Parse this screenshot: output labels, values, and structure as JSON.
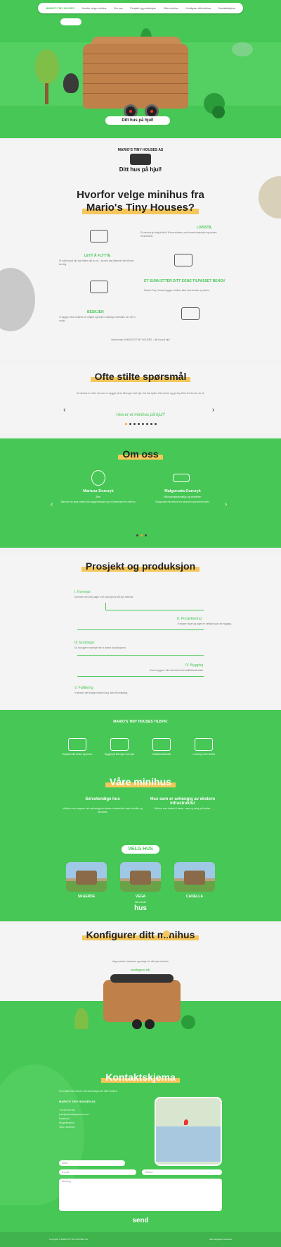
{
  "nav": {
    "logo": "MARIO'S TINY HOUSES",
    "items": [
      "Hvorfor velge minihus",
      "Om oss",
      "Prosjekt og produksjon",
      "Våre minihus",
      "Konfigurer ditt minihus",
      "Kontaktskjema"
    ]
  },
  "hero": {
    "tagline": "Ditt hus på hjul!"
  },
  "why": {
    "badge": "MARIO'S TINY HOUSES AS",
    "slogan": "Ditt hus på hjul!",
    "title_line1": "Hvorfor velge minihus fra",
    "title_line2": "Mario's Tiny Houses?",
    "features": [
      {
        "title": "LIVSSTIL",
        "text": "Et minihus gir deg frihet til å leve enklere, med lavere kostnader og mindre ressursbruk."
      },
      {
        "title": "LETT Å FLYTTE",
        "text": "Et minihus på hjul kan flyttes når du vil – ta med deg hjemmet ditt dit livet tar deg."
      },
      {
        "title": "ET SUNN ETTER DITT EGNE TILPASSET BEHOV",
        "text": "Mario's Tiny Houses bygger minihus etter dine ønsker og behov."
      },
      {
        "title": "BESKJEN",
        "text": "Vi bygger med omtanke for miljøet og bruker naturlige materialer der det er mulig."
      }
    ],
    "footnote": "Velkommen til MARIO'S TINY HOUSES – ditt hus på hjul!"
  },
  "faq": {
    "title": "Ofte stilte spørsmål",
    "text": "Et minihus er et lite hus som er bygget på en tilhenger med hjul. Det kan flyttes etter behov og gir deg frihet til å bo der du vil.",
    "question": "Hva er et minihus på hjul?",
    "slides": 8,
    "active": 0
  },
  "about": {
    "title": "Om oss",
    "people": [
      {
        "name": "Mariusz Durczyk",
        "role": "Eier",
        "text": "Mariusz har lang erfaring fra byggebransjen og en lidenskap for små hus."
      },
      {
        "name": "Malgorzata Durczyk",
        "role": "Økonomiansvarlig og medeier",
        "text": "Malgorzata har ansvar for økonomi og kundekontakt."
      }
    ],
    "slides": 3,
    "active": 1
  },
  "project": {
    "title": "Prosjekt og produksjon",
    "steps": [
      {
        "title": "I. Konsept",
        "text": "Sammen med deg lager vi et konsept for ditt nye minihus."
      },
      {
        "title": "II. Prosjektering",
        "text": "Vi tegner huset og lager en detaljert plan for bygging."
      },
      {
        "title": "III. Endringer",
        "text": "Du kan gjøre endringer før vi starter produksjonen."
      },
      {
        "title": "IV. Bygging",
        "text": "Huset bygges i vårt verksted med kvalitetsmaterialer."
      },
      {
        "title": "V. Fullføring",
        "text": "Vi leverer det ferdige huset til deg, klart til innflytting."
      }
    ]
  },
  "offer": {
    "title": "MARIO'S TINY HOUSES TILBYR:",
    "items": [
      "Tilpasset ditt ønske og behov",
      "Bygget på tilhenger med hjul",
      "Kvalitetsmaterialer",
      "Levering i hele landet"
    ]
  },
  "houses": {
    "title": "Våre minihus",
    "col1_title": "Selvstendige hus",
    "col1_text": "Minihus som fungerer helt uavhengig av ekstern infrastruktur med solceller og vanntank.",
    "col2_title": "Hus som er avhengig av ekstern infrastruktur",
    "col2_text": "Minihus som kobles til strøm, vann og avløp på tomten.",
    "select_label": "VELG HUS",
    "cards": [
      "SKAERDE",
      "VEGA",
      "CADELLA"
    ],
    "link_small": "ditt neste",
    "link_big": "hus"
  },
  "config": {
    "title": "Konfigurer ditt minihus",
    "text": "Velg modell, størrelse og utstyr for ditt nye minihus.",
    "button": "Konfigurer nå!"
  },
  "contact": {
    "title": "Kontaktskjema",
    "intro": "Ta kontakt med oss for mer informasjon om våre minihus.",
    "company": "MARIO'S TINY HOUSES AS",
    "lines": [
      "+47 000 00 000",
      "post@mariostinyhouses.com",
      "Facebook",
      "Ringeriksveien",
      "3510 Hønefoss"
    ],
    "placeholders": {
      "name": "Navn",
      "email": "E-post",
      "phone": "Telefon",
      "message": "Melding"
    },
    "send": "send"
  },
  "footer": {
    "left": "Copyright © MARIO'S TINY HOUSES AS",
    "right": "Alle rettigheter reservert"
  },
  "colors": {
    "green": "#47c755",
    "accent": "#f5c65a",
    "orange": "#f5a623"
  }
}
